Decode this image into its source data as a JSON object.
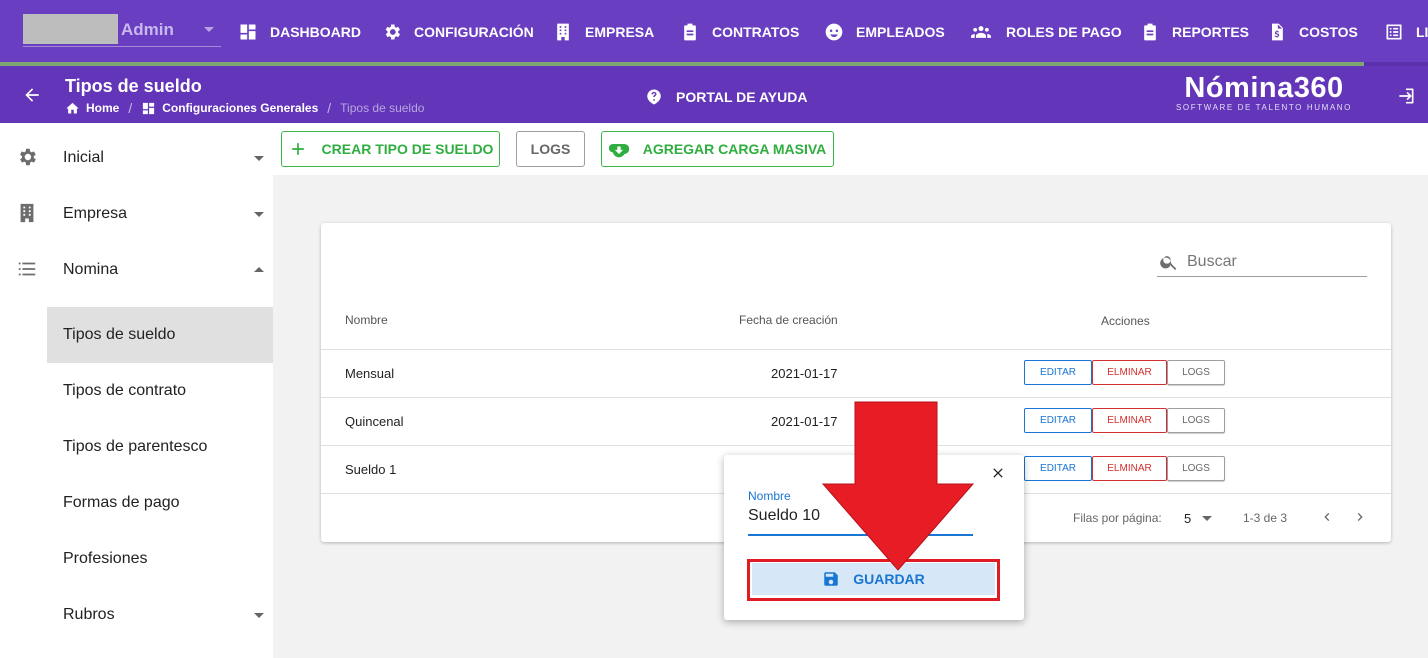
{
  "topnav": {
    "user_label": "Admin",
    "items": [
      {
        "label": "DASHBOARD",
        "icon": "dashboard-icon"
      },
      {
        "label": "CONFIGURACIÓN",
        "icon": "gear-icon"
      },
      {
        "label": "EMPRESA",
        "icon": "building-icon"
      },
      {
        "label": "CONTRATOS",
        "icon": "clipboard-icon"
      },
      {
        "label": "EMPLEADOS",
        "icon": "face-icon"
      },
      {
        "label": "ROLES DE PAGO",
        "icon": "people-icon"
      },
      {
        "label": "REPORTES",
        "icon": "clipboard-icon"
      },
      {
        "label": "COSTOS",
        "icon": "invoice-icon"
      },
      {
        "label": "LI",
        "icon": "list-icon"
      }
    ],
    "progress_fraction": 0.955
  },
  "header": {
    "title": "Tipos de sueldo",
    "breadcrumb": [
      "Home",
      "Configuraciones Generales",
      "Tipos de sueldo"
    ],
    "help_label": "PORTAL DE AYUDA",
    "brand_name": "Nómina360",
    "brand_tagline": "SOFTWARE DE TALENTO HUMANO"
  },
  "sidebar": {
    "sections": [
      {
        "label": "Inicial",
        "icon": "gear-icon",
        "expanded": false
      },
      {
        "label": "Empresa",
        "icon": "building-icon",
        "expanded": false
      },
      {
        "label": "Nomina",
        "icon": "list-icon",
        "expanded": true
      }
    ],
    "nomina_items": [
      "Tipos de sueldo",
      "Tipos de contrato",
      "Tipos de parentesco",
      "Formas de pago",
      "Profesiones",
      "Rubros"
    ],
    "active_item": "Tipos de sueldo"
  },
  "toolbar": {
    "create_label": "CREAR TIPO DE SUELDO",
    "logs_label": "LOGS",
    "bulk_label": "AGREGAR CARGA MASIVA"
  },
  "table": {
    "search_placeholder": "Buscar",
    "columns": [
      "Nombre",
      "Fecha de creación",
      "Acciones"
    ],
    "rows": [
      {
        "nombre": "Mensual",
        "fecha": "2021-01-17"
      },
      {
        "nombre": "Quincenal",
        "fecha": "2021-01-17"
      },
      {
        "nombre": "Sueldo 1",
        "fecha": ""
      }
    ],
    "actions": {
      "edit": "EDITAR",
      "delete": "ELMINAR",
      "logs": "LOGS"
    },
    "pagination": {
      "rows_per_page_label": "Filas por página:",
      "rows_per_page": "5",
      "range": "1-3 de 3"
    }
  },
  "popup": {
    "field_label": "Nombre",
    "field_value": "Sueldo 10",
    "save_label": "GUARDAR"
  },
  "colors": {
    "nav_purple": "#6a3ec0",
    "header_purple": "#6335b8",
    "green": "#2fae3f",
    "blue": "#1976d2",
    "red": "#d32f2f",
    "annotation_red": "#e01b24"
  }
}
